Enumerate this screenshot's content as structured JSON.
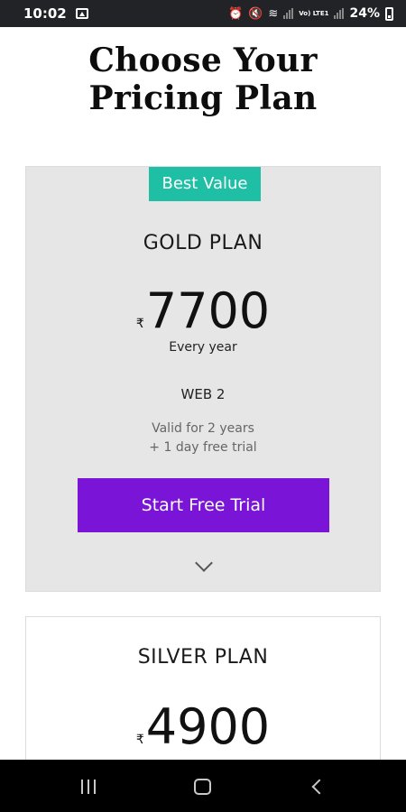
{
  "status_bar": {
    "time": "10:02",
    "battery": "24%",
    "volte_label": "Vo) LTE1"
  },
  "page": {
    "title_line1": "Choose Your",
    "title_line2": "Pricing Plan"
  },
  "plans": [
    {
      "badge": "Best Value",
      "name": "GOLD PLAN",
      "currency": "₹",
      "price": "7700",
      "period": "Every year",
      "tier": "WEB 2",
      "validity_line1": "Valid for 2 years",
      "validity_line2": "+ 1 day free trial",
      "cta_label": "Start Free Trial"
    },
    {
      "name": "SILVER PLAN",
      "currency": "₹",
      "price": "4900"
    }
  ],
  "colors": {
    "badge": "#1fbfa5",
    "cta": "#7a14d6",
    "gold_card_bg": "#e6e6e6"
  }
}
